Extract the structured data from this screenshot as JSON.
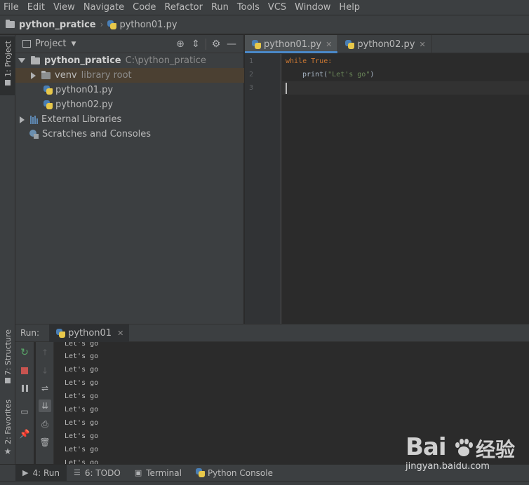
{
  "menu": [
    "File",
    "Edit",
    "View",
    "Navigate",
    "Code",
    "Refactor",
    "Run",
    "Tools",
    "VCS",
    "Window",
    "Help"
  ],
  "navbar": {
    "project": "python_pratice",
    "file": "python01.py"
  },
  "left_stripe": {
    "project": "1: Project",
    "structure": "7: Structure",
    "favorites": "2: Favorites"
  },
  "project_panel": {
    "title": "Project",
    "tree": {
      "root": "python_pratice",
      "root_path": "C:\\python_pratice",
      "venv": "venv",
      "venv_hint": "library root",
      "file1": "python01.py",
      "file2": "python02.py",
      "external": "External Libraries",
      "scratches": "Scratches and Consoles"
    }
  },
  "editor": {
    "tabs": [
      "python01.py",
      "python02.py"
    ],
    "line_numbers": [
      "1",
      "2",
      "3"
    ],
    "code": {
      "l1_kw": "while",
      "l1_val": "True",
      "l1_colon": ":",
      "l2_fn": "print",
      "l2_open": "(",
      "l2_str": "\"Let's go\"",
      "l2_close": ")"
    }
  },
  "run": {
    "label": "Run:",
    "tab": "python01",
    "output": [
      "Let's go",
      "Let's go",
      "Let's go",
      "Let's go",
      "Let's go",
      "Let's go",
      "Let's go",
      "Let's go",
      "Let's go",
      "Let's go"
    ]
  },
  "bottom_tabs": {
    "run": "4: Run",
    "todo": "6: TODO",
    "terminal": "Terminal",
    "console": "Python Console"
  },
  "watermark": {
    "logo": "Bai",
    "cn": "经验",
    "url": "jingyan.baidu.com"
  }
}
